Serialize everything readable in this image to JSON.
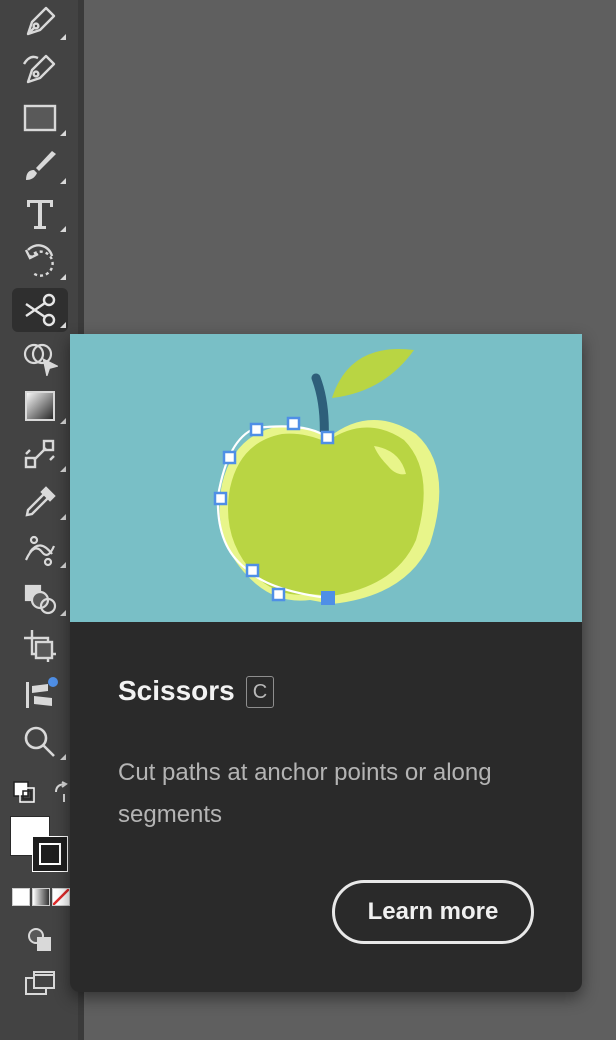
{
  "toolbar": {
    "tools": [
      {
        "name": "pen-tool",
        "icon": "pen-icon"
      },
      {
        "name": "curvature-tool",
        "icon": "curvature-pen-icon"
      },
      {
        "name": "rectangle-tool",
        "icon": "rectangle-icon"
      },
      {
        "name": "paintbrush-tool",
        "icon": "paintbrush-icon"
      },
      {
        "name": "type-tool",
        "icon": "type-icon"
      },
      {
        "name": "rotate-tool",
        "icon": "rotate-icon"
      },
      {
        "name": "scissors-tool",
        "icon": "scissors-icon",
        "active": true
      },
      {
        "name": "shape-builder-tool",
        "icon": "shape-builder-icon"
      },
      {
        "name": "gradient-tool",
        "icon": "gradient-icon"
      },
      {
        "name": "blend-tool",
        "icon": "blend-icon"
      },
      {
        "name": "eyedropper-tool",
        "icon": "eyedropper-icon"
      },
      {
        "name": "puppet-warp-tool",
        "icon": "puppet-warp-icon"
      },
      {
        "name": "symbol-sprayer-tool",
        "icon": "symbol-sprayer-icon"
      },
      {
        "name": "artboard-tool",
        "icon": "artboard-icon"
      },
      {
        "name": "edit-toolbar",
        "icon": "edit-toolbar-icon"
      },
      {
        "name": "zoom-tool",
        "icon": "zoom-icon"
      }
    ],
    "fill_color": "#ffffff",
    "stroke_color": "#1e1e1e"
  },
  "tooltip": {
    "title": "Scissors",
    "shortcut": "C",
    "description": "Cut paths at anchor points or along segments",
    "learn_more_label": "Learn more",
    "image": {
      "background": "#79bfc6",
      "apple_color": "#b9d543",
      "leaf_color": "#b9d543",
      "stem_color": "#2e5f7a",
      "highlight_color": "#e8f58a",
      "anchor_color": "#4f8fe6"
    }
  }
}
